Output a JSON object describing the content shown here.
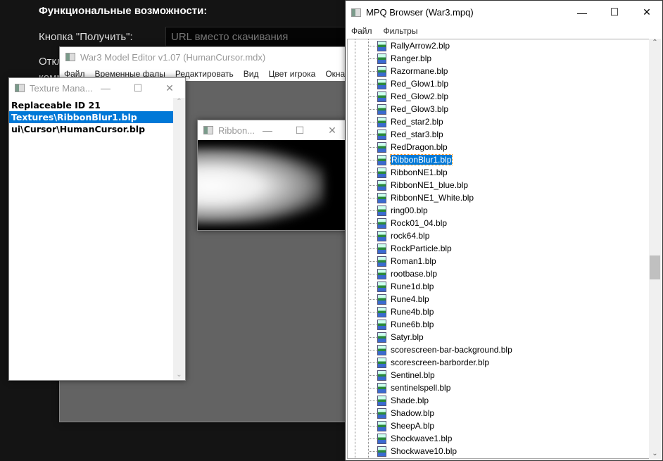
{
  "page": {
    "heading": "Функциональные возможности:",
    "get_button_label": "Кнопка \"Получить\":",
    "url_placeholder": "URL вместо скачивания",
    "label2": "Откл",
    "label3": "комм"
  },
  "editor": {
    "title": "War3 Model Editor v1.07 (HumanCursor.mdx)",
    "menu": [
      "Файл",
      "Временные фалы",
      "Редактировать",
      "Вид",
      "Цвет игрока",
      "Окна"
    ]
  },
  "texture_manager": {
    "title": "Texture Mana...",
    "items": [
      "Replaceable ID 21",
      "Textures\\RibbonBlur1.blp",
      "ui\\Cursor\\HumanCursor.blp"
    ],
    "selected_index": 1
  },
  "ribbon": {
    "title": "Ribbon..."
  },
  "mpq": {
    "title": "MPQ Browser (War3.mpq)",
    "menu": [
      "Файл",
      "Фильтры"
    ],
    "selected": "RibbonBlur1.blp",
    "files": [
      "RallyArrow2.blp",
      "Ranger.blp",
      "Razormane.blp",
      "Red_Glow1.blp",
      "Red_Glow2.blp",
      "Red_Glow3.blp",
      "Red_star2.blp",
      "Red_star3.blp",
      "RedDragon.blp",
      "RibbonBlur1.blp",
      "RibbonNE1.blp",
      "RibbonNE1_blue.blp",
      "RibbonNE1_White.blp",
      "ring00.blp",
      "Rock01_04.blp",
      "rock64.blp",
      "RockParticle.blp",
      "Roman1.blp",
      "rootbase.blp",
      "Rune1d.blp",
      "Rune4.blp",
      "Rune4b.blp",
      "Rune6b.blp",
      "Satyr.blp",
      "scorescreen-bar-background.blp",
      "scorescreen-barborder.blp",
      "Sentinel.blp",
      "sentinelspell.blp",
      "Shade.blp",
      "Shadow.blp",
      "SheepA.blp",
      "Shockwave1.blp",
      "Shockwave10.blp"
    ],
    "scroll_position": 0.55
  },
  "window_controls": {
    "minimize": "—",
    "maximize": "☐",
    "close": "✕"
  }
}
